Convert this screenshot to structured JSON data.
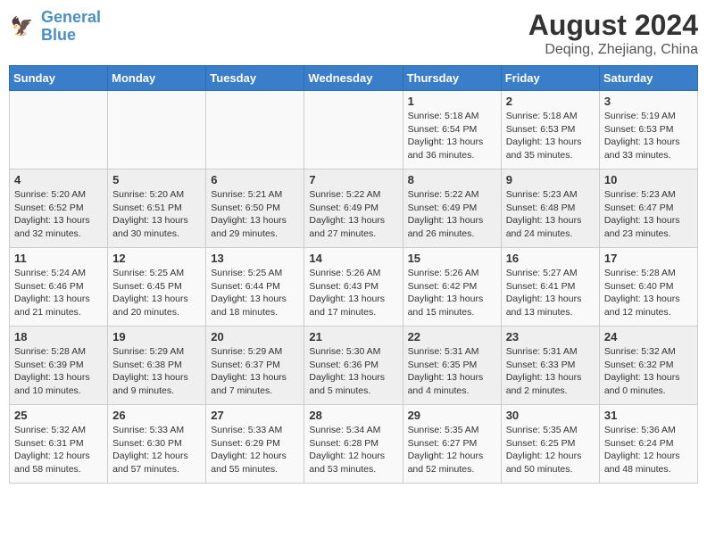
{
  "header": {
    "logo_line1": "General",
    "logo_line2": "Blue",
    "month_year": "August 2024",
    "location": "Deqing, Zhejiang, China"
  },
  "weekdays": [
    "Sunday",
    "Monday",
    "Tuesday",
    "Wednesday",
    "Thursday",
    "Friday",
    "Saturday"
  ],
  "weeks": [
    [
      {
        "day": "",
        "info": ""
      },
      {
        "day": "",
        "info": ""
      },
      {
        "day": "",
        "info": ""
      },
      {
        "day": "",
        "info": ""
      },
      {
        "day": "1",
        "info": "Sunrise: 5:18 AM\nSunset: 6:54 PM\nDaylight: 13 hours\nand 36 minutes."
      },
      {
        "day": "2",
        "info": "Sunrise: 5:18 AM\nSunset: 6:53 PM\nDaylight: 13 hours\nand 35 minutes."
      },
      {
        "day": "3",
        "info": "Sunrise: 5:19 AM\nSunset: 6:53 PM\nDaylight: 13 hours\nand 33 minutes."
      }
    ],
    [
      {
        "day": "4",
        "info": "Sunrise: 5:20 AM\nSunset: 6:52 PM\nDaylight: 13 hours\nand 32 minutes."
      },
      {
        "day": "5",
        "info": "Sunrise: 5:20 AM\nSunset: 6:51 PM\nDaylight: 13 hours\nand 30 minutes."
      },
      {
        "day": "6",
        "info": "Sunrise: 5:21 AM\nSunset: 6:50 PM\nDaylight: 13 hours\nand 29 minutes."
      },
      {
        "day": "7",
        "info": "Sunrise: 5:22 AM\nSunset: 6:49 PM\nDaylight: 13 hours\nand 27 minutes."
      },
      {
        "day": "8",
        "info": "Sunrise: 5:22 AM\nSunset: 6:49 PM\nDaylight: 13 hours\nand 26 minutes."
      },
      {
        "day": "9",
        "info": "Sunrise: 5:23 AM\nSunset: 6:48 PM\nDaylight: 13 hours\nand 24 minutes."
      },
      {
        "day": "10",
        "info": "Sunrise: 5:23 AM\nSunset: 6:47 PM\nDaylight: 13 hours\nand 23 minutes."
      }
    ],
    [
      {
        "day": "11",
        "info": "Sunrise: 5:24 AM\nSunset: 6:46 PM\nDaylight: 13 hours\nand 21 minutes."
      },
      {
        "day": "12",
        "info": "Sunrise: 5:25 AM\nSunset: 6:45 PM\nDaylight: 13 hours\nand 20 minutes."
      },
      {
        "day": "13",
        "info": "Sunrise: 5:25 AM\nSunset: 6:44 PM\nDaylight: 13 hours\nand 18 minutes."
      },
      {
        "day": "14",
        "info": "Sunrise: 5:26 AM\nSunset: 6:43 PM\nDaylight: 13 hours\nand 17 minutes."
      },
      {
        "day": "15",
        "info": "Sunrise: 5:26 AM\nSunset: 6:42 PM\nDaylight: 13 hours\nand 15 minutes."
      },
      {
        "day": "16",
        "info": "Sunrise: 5:27 AM\nSunset: 6:41 PM\nDaylight: 13 hours\nand 13 minutes."
      },
      {
        "day": "17",
        "info": "Sunrise: 5:28 AM\nSunset: 6:40 PM\nDaylight: 13 hours\nand 12 minutes."
      }
    ],
    [
      {
        "day": "18",
        "info": "Sunrise: 5:28 AM\nSunset: 6:39 PM\nDaylight: 13 hours\nand 10 minutes."
      },
      {
        "day": "19",
        "info": "Sunrise: 5:29 AM\nSunset: 6:38 PM\nDaylight: 13 hours\nand 9 minutes."
      },
      {
        "day": "20",
        "info": "Sunrise: 5:29 AM\nSunset: 6:37 PM\nDaylight: 13 hours\nand 7 minutes."
      },
      {
        "day": "21",
        "info": "Sunrise: 5:30 AM\nSunset: 6:36 PM\nDaylight: 13 hours\nand 5 minutes."
      },
      {
        "day": "22",
        "info": "Sunrise: 5:31 AM\nSunset: 6:35 PM\nDaylight: 13 hours\nand 4 minutes."
      },
      {
        "day": "23",
        "info": "Sunrise: 5:31 AM\nSunset: 6:33 PM\nDaylight: 13 hours\nand 2 minutes."
      },
      {
        "day": "24",
        "info": "Sunrise: 5:32 AM\nSunset: 6:32 PM\nDaylight: 13 hours\nand 0 minutes."
      }
    ],
    [
      {
        "day": "25",
        "info": "Sunrise: 5:32 AM\nSunset: 6:31 PM\nDaylight: 12 hours\nand 58 minutes."
      },
      {
        "day": "26",
        "info": "Sunrise: 5:33 AM\nSunset: 6:30 PM\nDaylight: 12 hours\nand 57 minutes."
      },
      {
        "day": "27",
        "info": "Sunrise: 5:33 AM\nSunset: 6:29 PM\nDaylight: 12 hours\nand 55 minutes."
      },
      {
        "day": "28",
        "info": "Sunrise: 5:34 AM\nSunset: 6:28 PM\nDaylight: 12 hours\nand 53 minutes."
      },
      {
        "day": "29",
        "info": "Sunrise: 5:35 AM\nSunset: 6:27 PM\nDaylight: 12 hours\nand 52 minutes."
      },
      {
        "day": "30",
        "info": "Sunrise: 5:35 AM\nSunset: 6:25 PM\nDaylight: 12 hours\nand 50 minutes."
      },
      {
        "day": "31",
        "info": "Sunrise: 5:36 AM\nSunset: 6:24 PM\nDaylight: 12 hours\nand 48 minutes."
      }
    ]
  ]
}
